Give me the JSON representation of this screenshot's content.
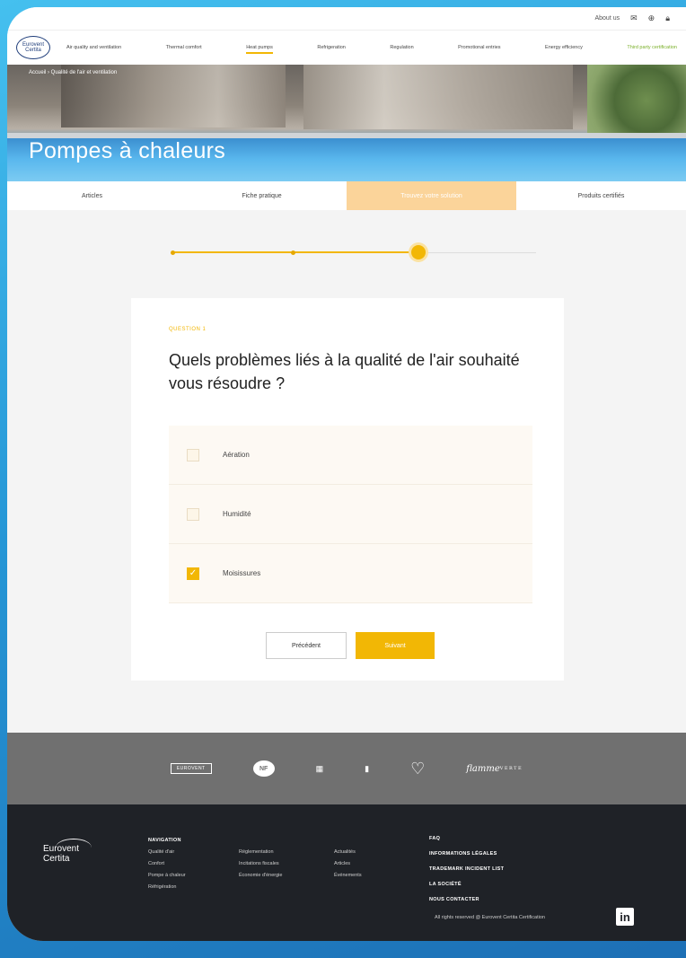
{
  "colors": {
    "accent": "#f2b705",
    "footer_bg": "#1f2227",
    "partners_bg": "#707070",
    "tab_active": "#fbd49a"
  },
  "utilbar": {
    "about": "About us",
    "mail_icon": "mail-icon",
    "lang": "⊕",
    "lock_icon": "lock-icon"
  },
  "logo": {
    "line1": "Eurovent",
    "line2": "Certita"
  },
  "nav": {
    "items": [
      {
        "label": "Air quality and ventilation"
      },
      {
        "label": "Thermal comfort"
      },
      {
        "label": "Heat pumps"
      },
      {
        "label": "Refrigeration"
      },
      {
        "label": "Regulation"
      },
      {
        "label": "Promotional entries"
      },
      {
        "label": "Energy efficiency"
      },
      {
        "label": "Third party certification"
      }
    ]
  },
  "hero": {
    "breadcrumb": "Accueil  ›  Qualité de l'air et ventilation",
    "title": "Pompes à chaleurs"
  },
  "tabs": [
    {
      "label": "Articles"
    },
    {
      "label": "Fiche pratique"
    },
    {
      "label": "Trouvez votre solution"
    },
    {
      "label": "Produits certifiés"
    }
  ],
  "progress": {
    "step": 3,
    "total": 4
  },
  "quiz": {
    "label": "QUESTION 1",
    "question": "Quels problèmes liés à la qualité de l'air souhaité vous résoudre ?",
    "options": [
      {
        "label": "Aération",
        "checked": false
      },
      {
        "label": "Humidité",
        "checked": false
      },
      {
        "label": "Moisissures",
        "checked": true
      }
    ],
    "prev_label": "Précédent",
    "next_label": "Suivant"
  },
  "partners": {
    "p1": "EUROVENT",
    "p2": "NF",
    "p3": "▦",
    "p4": "▮",
    "p5": "♡",
    "p6_line1": "flamme",
    "p6_line2": "VERTE"
  },
  "footer": {
    "logo_line1": "Eurovent",
    "logo_line2": "Certita",
    "nav_head": "NAVIGATION",
    "col1": [
      "Qualité d'air",
      "Confort",
      "Pompe à chaleur",
      "Réfrigération"
    ],
    "col2": [
      "Réglementation",
      "Incitations fiscales",
      "Économie d'énergie"
    ],
    "col3": [
      "Actualités",
      "Articles",
      "Événements"
    ],
    "links": [
      "FAQ",
      "INFORMATIONS LÉGALES",
      "TRADEMARK INCIDENT LIST",
      "LA SOCIÉTÉ",
      "NOUS CONTACTER"
    ],
    "copyright": "All rights reserved @ Eurovent Certita Certification",
    "linkedin": "in"
  }
}
